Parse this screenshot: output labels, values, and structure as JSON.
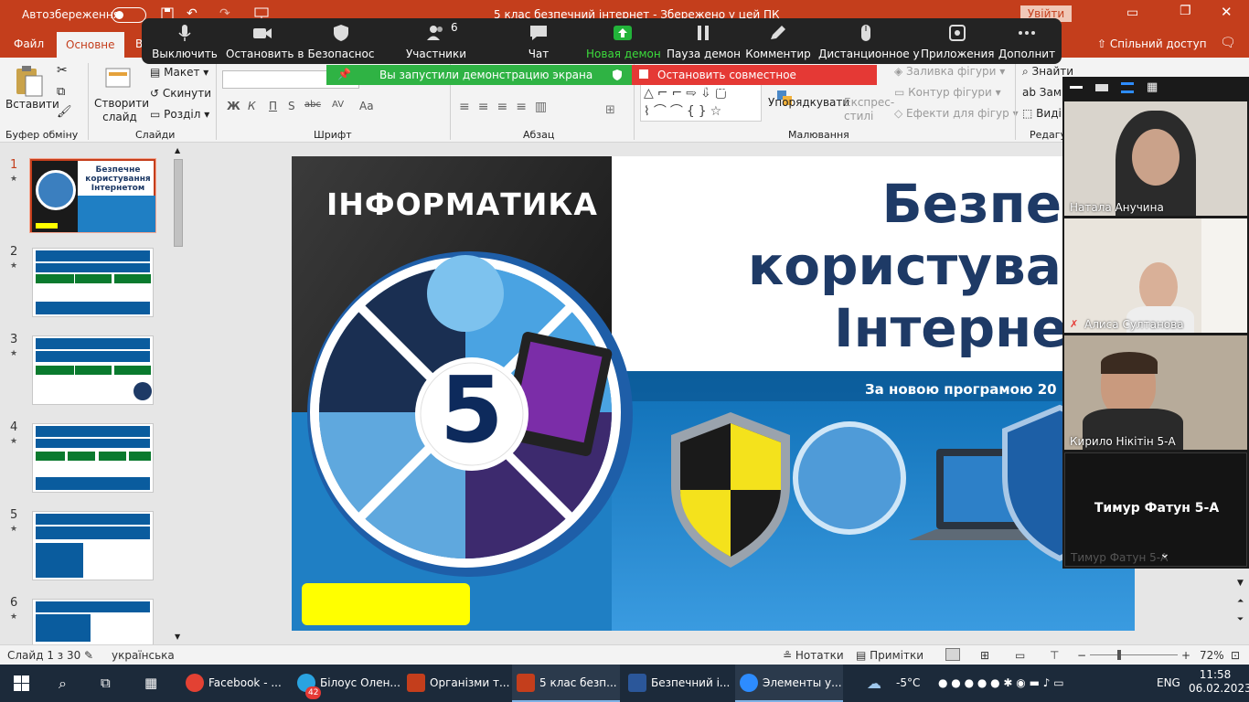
{
  "title_bar": {
    "autosave_label": "Автозбереження",
    "doc_title": "5 клас безпечний інтернет  -  Збережено у цей ПК",
    "signin": "Увійти"
  },
  "ribbon_tabs": [
    "Файл",
    "Основне",
    "В"
  ],
  "share_label": "Спільний доступ",
  "ribbon": {
    "paste": "Вставити",
    "clipboard_group": "Буфер обміну",
    "new_slide": "Створити слайд",
    "layout": "Макет",
    "reset": "Скинути",
    "section": "Розділ",
    "slides_group": "Слайди",
    "font_group": "Шрифт",
    "paragraph_group": "Абзац",
    "arrange": "Упорядкувати",
    "quick_styles": "Експрес-стилі",
    "shape_fill": "Заливка фігури",
    "shape_outline": "Контур фігури",
    "shape_effects": "Ефекти для фігур",
    "drawing_group": "Малювання",
    "find": "Знайти",
    "replace": "Замі",
    "select": "Виді",
    "editing_group": "Редагу",
    "font_buttons": [
      "Ж",
      "К",
      "П",
      "S",
      "abc",
      "AV",
      "Aa"
    ]
  },
  "zoom_toolbar": {
    "mute": "Выключить",
    "stop_video": "Остановить в",
    "security": "Безопаснос",
    "participants": "Участники",
    "participants_count": "6",
    "chat": "Чат",
    "new_share": "Новая демон",
    "pause_share": "Пауза демон",
    "annotate": "Комментир",
    "remote_control": "Дистанционное у",
    "apps": "Приложения",
    "more": "Дополнит",
    "sharing_notice": "Вы запустили демонстрацию экрана",
    "stop_share": "Остановить совместное использование"
  },
  "thumbnails": [
    {
      "num": "1",
      "title": "Безпечне користування Інтернетом"
    },
    {
      "num": "2"
    },
    {
      "num": "3"
    },
    {
      "num": "4"
    },
    {
      "num": "5"
    },
    {
      "num": "6"
    }
  ],
  "slide": {
    "brand": "ІНФОРМАТИКА",
    "title_line1": "Безпечн",
    "title_line2": "користуванн",
    "title_line3": "Інтернето",
    "subtitle": "За новою програмою 20",
    "grade": "5"
  },
  "participants": [
    {
      "name": "Натала Анучина",
      "muted": false
    },
    {
      "name": "Алиса Султанова",
      "muted": true
    },
    {
      "name": "Кирило Нікітін 5-А",
      "muted": false
    },
    {
      "name": "Тимур Фатун 5-А",
      "muted": false
    }
  ],
  "status_bar": {
    "slide_info": "Слайд 1 з 30",
    "language": "українська",
    "notes": "Нотатки",
    "comments": "Примітки",
    "zoom": "72%"
  },
  "taskbar": {
    "apps": [
      {
        "label": "Facebook - ...",
        "color": "#e34133"
      },
      {
        "label": "Білоус Олен...",
        "color": "#2aa3e0"
      },
      {
        "label": "Організми т...",
        "color": "#c43e1c"
      },
      {
        "label": "5 клас безп...",
        "color": "#c43e1c"
      },
      {
        "label": "Безпечний і...",
        "color": "#2b579a"
      },
      {
        "label": "Элементы у...",
        "color": "#2d8cff"
      }
    ],
    "telegram_badge": "42",
    "temperature": "-5°C",
    "lang": "ENG",
    "time": "11:58",
    "date": "06.02.2023"
  },
  "colors": {
    "ppt_red": "#c43e1c",
    "zoom_dark": "#232323",
    "share_green": "#2fb344",
    "stop_red": "#e53935",
    "slide_navy": "#1e3a66"
  }
}
